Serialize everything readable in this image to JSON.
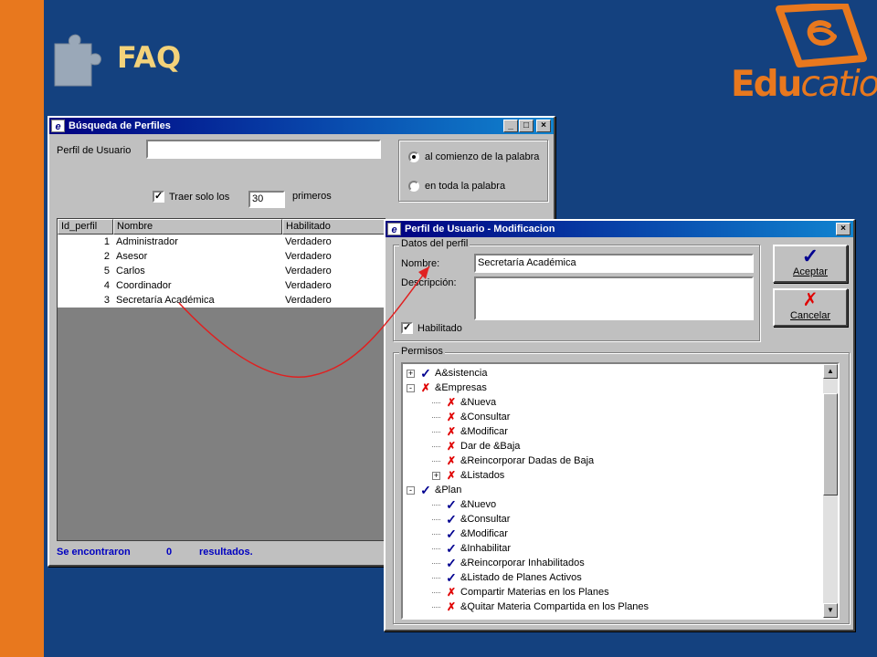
{
  "slide": {
    "title": "FAQ",
    "logo_text_edu": "Edu",
    "logo_text_catio": "catio",
    "logo_reg": "®"
  },
  "search_window": {
    "title": "Búsqueda de  Perfiles",
    "perfil_label": "Perfil de Usuario",
    "perfil_value": "",
    "option_start": "al comienzo de la palabra",
    "option_all": "en toda la palabra",
    "selected_option": "al comienzo de la palabra",
    "traer_label": "Traer solo los",
    "traer_checked": true,
    "traer_value": "30",
    "primeros_label": "primeros",
    "columns": [
      "Id_perfil",
      "Nombre",
      "Habilitado"
    ],
    "rows": [
      {
        "id": "1",
        "nombre": "Administrador",
        "habilitado": "Verdadero"
      },
      {
        "id": "2",
        "nombre": "Asesor",
        "habilitado": "Verdadero"
      },
      {
        "id": "5",
        "nombre": "Carlos",
        "habilitado": "Verdadero"
      },
      {
        "id": "4",
        "nombre": "Coordinador",
        "habilitado": "Verdadero"
      },
      {
        "id": "3",
        "nombre": "Secretaría Académica",
        "habilitado": "Verdadero"
      }
    ],
    "status_prefix": "Se encontraron",
    "status_count": "0",
    "status_suffix": "resultados."
  },
  "edit_window": {
    "title": "Perfil de Usuario - Modificacion",
    "datos_group": "Datos del perfil",
    "nombre_label": "Nombre:",
    "nombre_value": "Secretaría Académica",
    "descripcion_label": "Descripción:",
    "descripcion_value": "",
    "habilitado_label": "Habilitado",
    "habilitado_checked": true,
    "aceptar_label": "Aceptar",
    "cancelar_label": "Cancelar",
    "permisos_group": "Permisos",
    "tree": [
      {
        "label": "A&sistencia",
        "mark": "ok",
        "level": 0,
        "expander": "+"
      },
      {
        "label": "&Empresas",
        "mark": "x",
        "level": 0,
        "expander": "-"
      },
      {
        "label": "&Nueva",
        "mark": "x",
        "level": 1,
        "expander": ""
      },
      {
        "label": "&Consultar",
        "mark": "x",
        "level": 1,
        "expander": ""
      },
      {
        "label": "&Modificar",
        "mark": "x",
        "level": 1,
        "expander": ""
      },
      {
        "label": "Dar de &Baja",
        "mark": "x",
        "level": 1,
        "expander": ""
      },
      {
        "label": "&Reincorporar Dadas de Baja",
        "mark": "x",
        "level": 1,
        "expander": ""
      },
      {
        "label": "&Listados",
        "mark": "x",
        "level": 1,
        "expander": "+"
      },
      {
        "label": "&Plan",
        "mark": "ok",
        "level": 0,
        "expander": "-"
      },
      {
        "label": "&Nuevo",
        "mark": "ok",
        "level": 1,
        "expander": ""
      },
      {
        "label": "&Consultar",
        "mark": "ok",
        "level": 1,
        "expander": ""
      },
      {
        "label": "&Modificar",
        "mark": "ok",
        "level": 1,
        "expander": ""
      },
      {
        "label": "&Inhabilitar",
        "mark": "ok",
        "level": 1,
        "expander": ""
      },
      {
        "label": "&Reincorporar Inhabilitados",
        "mark": "ok",
        "level": 1,
        "expander": ""
      },
      {
        "label": "&Listado de Planes Activos",
        "mark": "ok",
        "level": 1,
        "expander": ""
      },
      {
        "label": "Compartir Materias en los Planes",
        "mark": "x",
        "level": 1,
        "expander": ""
      },
      {
        "label": "&Quitar Materia Compartida en los Planes",
        "mark": "x",
        "level": 1,
        "expander": ""
      }
    ]
  },
  "colors": {
    "background": "#14417f",
    "accent_orange": "#e8781e",
    "title_yellow": "#f3d27a",
    "check_blue": "#000090",
    "cross_red": "#e00000",
    "arrow_red": "#e02020"
  }
}
